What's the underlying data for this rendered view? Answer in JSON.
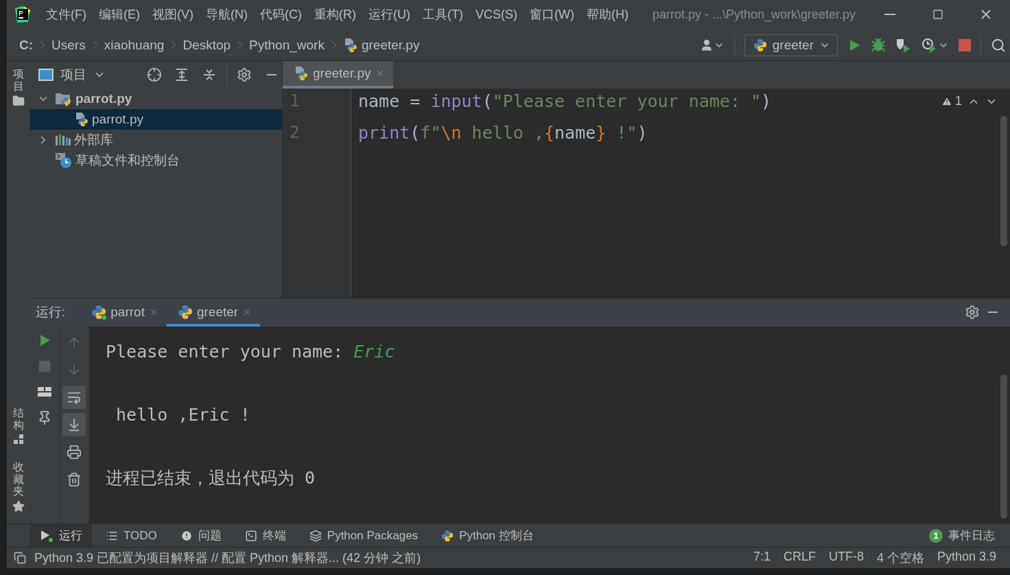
{
  "title_bar": {
    "menus": [
      "文件(F)",
      "编辑(E)",
      "视图(V)",
      "导航(N)",
      "代码(C)",
      "重构(R)",
      "运行(U)",
      "工具(T)",
      "VCS(S)",
      "窗口(W)",
      "帮助(H)"
    ],
    "title": "parrot.py - ...\\Python_work\\greeter.py"
  },
  "nav_bar": {
    "breadcrumbs": [
      {
        "label": "C:",
        "kind": "drive"
      },
      {
        "label": "Users",
        "kind": "folder"
      },
      {
        "label": "xiaohuang",
        "kind": "folder"
      },
      {
        "label": "Desktop",
        "kind": "folder"
      },
      {
        "label": "Python_work",
        "kind": "folder"
      },
      {
        "label": "greeter.py",
        "kind": "file"
      }
    ],
    "run_config": "greeter"
  },
  "side_stripe": {
    "top": [
      {
        "label": "项目",
        "kind": "folder"
      }
    ],
    "bottom": [
      {
        "label": "结构",
        "kind": "structure"
      },
      {
        "label": "收藏夹",
        "kind": "star"
      }
    ]
  },
  "project_panel": {
    "title": "项目",
    "tree": [
      {
        "label": "parrot.py",
        "kind": "folder",
        "expanded": true,
        "selected": false,
        "children": [
          {
            "label": "parrot.py",
            "kind": "file",
            "selected": true
          }
        ]
      },
      {
        "label": "外部库",
        "kind": "library",
        "expanded": false,
        "selected": false
      },
      {
        "label": "草稿文件和控制台",
        "kind": "scratch",
        "selected": false
      }
    ]
  },
  "editor": {
    "tabs": [
      {
        "label": "greeter.py",
        "selected": true
      }
    ],
    "warnings": "1",
    "lines": [
      {
        "number": "1",
        "tokens": [
          {
            "text": "name",
            "kind": "ident"
          },
          {
            "text": " = ",
            "kind": "op"
          },
          {
            "text": "input",
            "kind": "builtin"
          },
          {
            "text": "(",
            "kind": "op"
          },
          {
            "text": "\"Please enter your name: \"",
            "kind": "string"
          },
          {
            "text": ")",
            "kind": "op"
          }
        ]
      },
      {
        "number": "2",
        "tokens": [
          {
            "text": "print",
            "kind": "builtin"
          },
          {
            "text": "(",
            "kind": "op"
          },
          {
            "text": "f\"",
            "kind": "string"
          },
          {
            "text": "\\n",
            "kind": "escape"
          },
          {
            "text": " hello ,",
            "kind": "string"
          },
          {
            "text": "{",
            "kind": "escape"
          },
          {
            "text": "name",
            "kind": "ident"
          },
          {
            "text": "}",
            "kind": "escape"
          },
          {
            "text": " !\"",
            "kind": "string"
          },
          {
            "text": ")",
            "kind": "op"
          }
        ]
      }
    ]
  },
  "run_panel": {
    "label": "运行:",
    "tabs": [
      {
        "label": "parrot",
        "selected": false,
        "running": true
      },
      {
        "label": "greeter",
        "selected": true,
        "running": false
      }
    ],
    "actions": [
      {
        "kind": "rerun",
        "disabled": false
      },
      {
        "kind": "stop",
        "disabled": true
      },
      {
        "kind": "layout",
        "disabled": false
      },
      {
        "kind": "pin",
        "disabled": false
      }
    ],
    "console_tools": [
      {
        "kind": "up",
        "on": false,
        "disabled": true
      },
      {
        "kind": "down",
        "on": false,
        "disabled": true
      },
      {
        "kind": "wrap",
        "on": true,
        "disabled": false
      },
      {
        "kind": "scroll-end",
        "on": true,
        "disabled": false
      },
      {
        "kind": "print",
        "on": false,
        "disabled": false
      },
      {
        "kind": "trash",
        "on": false,
        "disabled": false
      }
    ],
    "console": [
      {
        "text": "Please enter your name: ",
        "input": "Eric"
      },
      {
        "text": " hello ,Eric !"
      },
      {
        "text": "进程已结束，退出代码为 0"
      }
    ]
  },
  "tool_tabs": [
    {
      "label": "运行",
      "kind": "run",
      "selected": true
    },
    {
      "label": "TODO",
      "kind": "todo",
      "selected": false
    },
    {
      "label": "问题",
      "kind": "problems",
      "selected": false
    },
    {
      "label": "终端",
      "kind": "terminal",
      "selected": false
    },
    {
      "label": "Python Packages",
      "kind": "packages",
      "selected": false
    },
    {
      "label": "Python 控制台",
      "kind": "console",
      "selected": false
    }
  ],
  "event_log": {
    "count": "1",
    "label": "事件日志"
  },
  "status_bar": {
    "message": "Python 3.9 已配置为项目解释器 // 配置 Python 解释器... (42 分钟 之前)",
    "items": [
      "7:1",
      "CRLF",
      "UTF-8",
      "4 个空格",
      "Python 3.9"
    ]
  }
}
